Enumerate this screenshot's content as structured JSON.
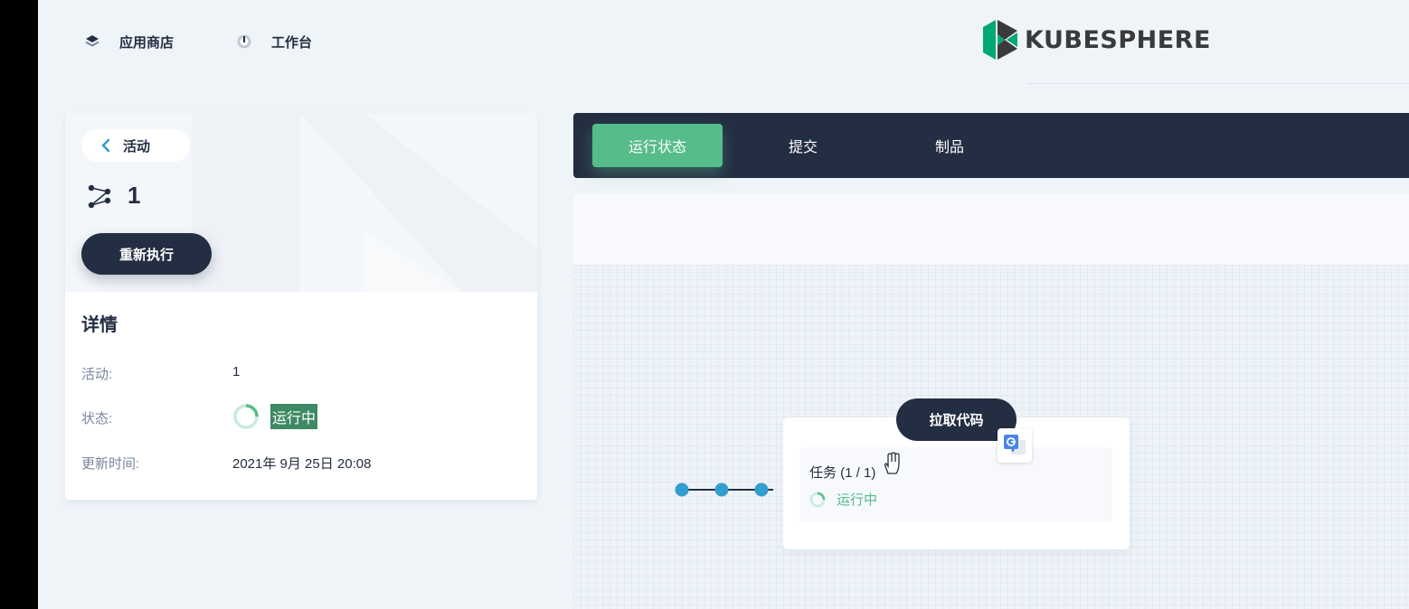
{
  "header": {
    "nav": [
      {
        "label": "应用商店",
        "icon": "layers-icon"
      },
      {
        "label": "工作台",
        "icon": "dashboard-icon"
      }
    ],
    "logo_text": "KUBESPHERE"
  },
  "left_card": {
    "back_label": "活动",
    "run_number": "1",
    "rerun_label": "重新执行",
    "detail_title": "详情",
    "details": [
      {
        "key": "活动:",
        "value": "1"
      },
      {
        "key": "状态:",
        "value": "运行中"
      },
      {
        "key": "更新时间:",
        "value": "2021年 9月 25日 20:08"
      }
    ]
  },
  "tabs": [
    {
      "label": "运行状态",
      "active": true
    },
    {
      "label": "提交",
      "active": false
    },
    {
      "label": "制品",
      "active": false
    }
  ],
  "pipeline": {
    "stage_name": "拉取代码",
    "task_label": "任务 (1 / 1)",
    "task_status": "运行中"
  },
  "colors": {
    "primary_dark": "#242e42",
    "accent_green": "#55bc8a",
    "highlight_green": "#3e8a63",
    "node_blue": "#329dce"
  }
}
